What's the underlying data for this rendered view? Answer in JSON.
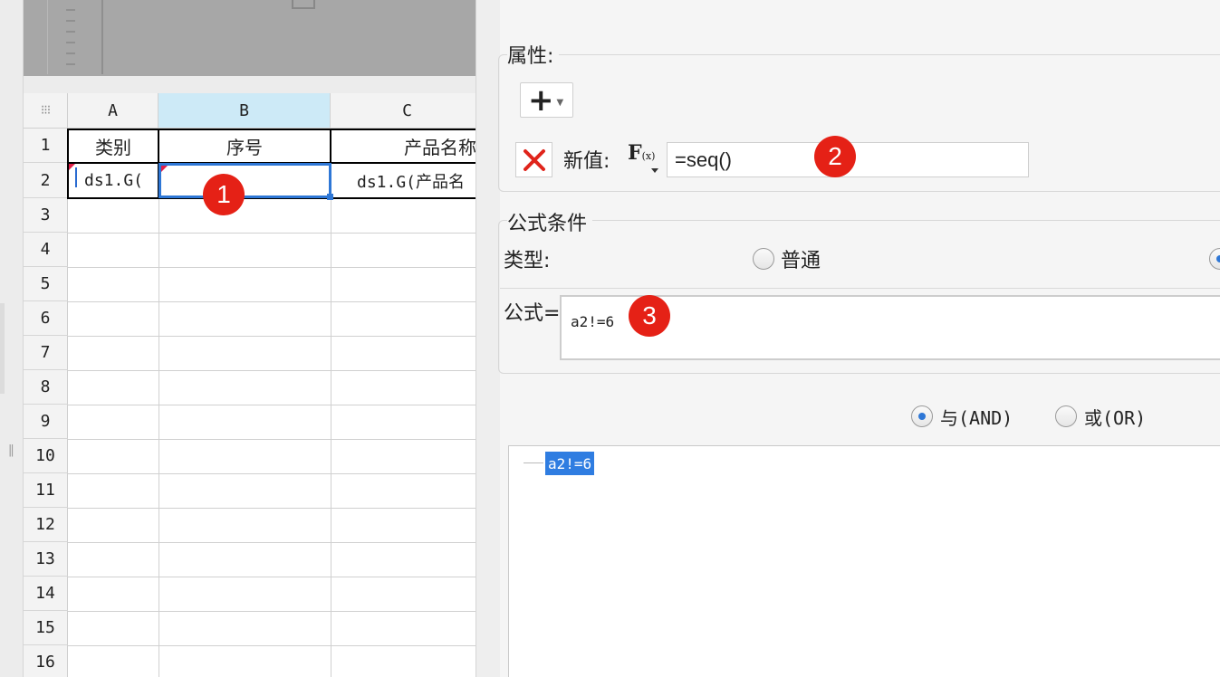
{
  "spreadsheet": {
    "corner_icon": "grid-dots",
    "columns": [
      "A",
      "B",
      "C"
    ],
    "selected_column": "B",
    "rows": [
      "1",
      "2",
      "3",
      "4",
      "5",
      "6",
      "7",
      "8",
      "9",
      "10",
      "11",
      "12",
      "13",
      "14",
      "15",
      "16"
    ],
    "header_row": [
      "类别",
      "序号",
      "产品名称"
    ],
    "data_row": [
      "ds1.G(",
      "",
      "ds1.G(产品名"
    ],
    "selected_cell": "B2"
  },
  "badges": [
    "1",
    "2",
    "3"
  ],
  "panel": {
    "properties_label": "属性:",
    "add_button": "+",
    "delete_icon": "red-x",
    "new_value_label": "新值:",
    "fx_icon": "F",
    "fx_sub": "(x)",
    "new_value": "=seq()",
    "formula_condition_label": "公式条件",
    "type_label": "类型:",
    "type_option_normal": "普通",
    "formula_label": "公式=",
    "formula_value": "a2!=6",
    "and_label": "与(AND)",
    "or_label": "或(OR)",
    "tree_node": "a2!=6",
    "selected_logic": "AND"
  },
  "colors": {
    "accent": "#2e77d6",
    "badge": "#e52116",
    "delete": "#e0241b",
    "selected_column_header": "#cdeaf7"
  }
}
